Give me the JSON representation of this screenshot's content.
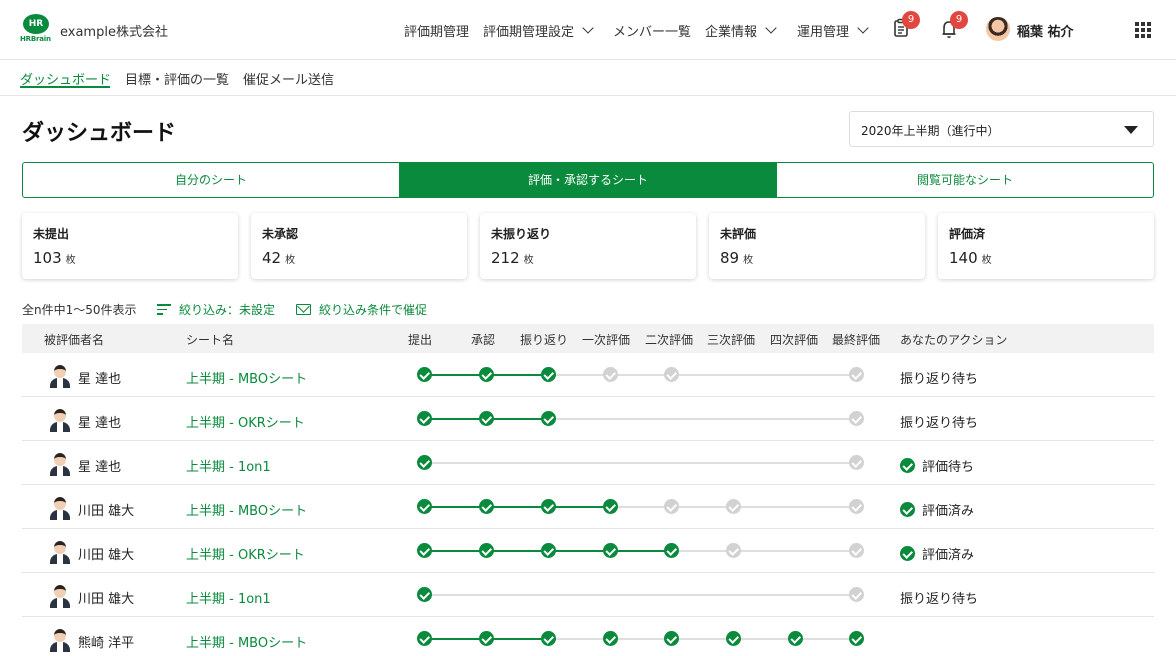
{
  "header": {
    "logo_text": "HR",
    "logo_sub": "HRBrain",
    "company": "example株式会社",
    "nav": [
      {
        "label": "評価期管理",
        "dropdown": false
      },
      {
        "label": "評価期管理設定",
        "dropdown": true
      },
      {
        "label": "メンバー一覧",
        "dropdown": false
      },
      {
        "label": "企業情報",
        "dropdown": true
      },
      {
        "label": "運用管理",
        "dropdown": true
      }
    ],
    "tasks_badge": "9",
    "notifications_badge": "9",
    "user_name": "稲葉 祐介"
  },
  "subnav": {
    "items": [
      "ダッシュボード",
      "目標・評価の一覧",
      "催促メール送信"
    ],
    "active": "ダッシュボード"
  },
  "page": {
    "title": "ダッシュボード",
    "period": "2020年上半期（進行中）"
  },
  "tabs": {
    "items": [
      "自分のシート",
      "評価・承認するシート",
      "閲覧可能なシート"
    ],
    "active_index": 1
  },
  "summary": {
    "unit": "枚",
    "cards": [
      {
        "label": "未提出",
        "value": "103"
      },
      {
        "label": "未承認",
        "value": "42"
      },
      {
        "label": "未振り返り",
        "value": "212"
      },
      {
        "label": "未評価",
        "value": "89"
      },
      {
        "label": "評価済",
        "value": "140"
      }
    ]
  },
  "list": {
    "count_text": "全n件中1〜50件表示",
    "filter_text": "絞り込み：未設定",
    "remind_text": "絞り込み条件で催促"
  },
  "table": {
    "columns": {
      "evaluatee": "被評価者名",
      "sheet": "シート名",
      "steps": [
        "提出",
        "承認",
        "振り返り",
        "一次評価",
        "二次評価",
        "三次評価",
        "四次評価",
        "最終評価"
      ],
      "action": "あなたのアクション"
    },
    "rows": [
      {
        "name": "星 達也",
        "sheet": "上半期 - MBOシート",
        "steps": [
          "done",
          "done",
          "done",
          "todo",
          "todo",
          null,
          null,
          "todo"
        ],
        "fill_to": 2,
        "action": "振り返り待ち",
        "action_ok": false
      },
      {
        "name": "星 達也",
        "sheet": "上半期 -  OKRシート",
        "steps": [
          "done",
          "done",
          "done",
          null,
          null,
          null,
          null,
          "todo"
        ],
        "fill_to": 2,
        "action": "振り返り待ち",
        "action_ok": false
      },
      {
        "name": "星 達也",
        "sheet": "上半期 - 1on1",
        "steps": [
          "done",
          null,
          null,
          null,
          null,
          null,
          null,
          "todo"
        ],
        "fill_to": 0,
        "action": "評価待ち",
        "action_ok": true
      },
      {
        "name": "川田 雄大",
        "sheet": "上半期 - MBOシート",
        "steps": [
          "done",
          "done",
          "done",
          "done",
          "todo",
          "todo",
          null,
          "todo"
        ],
        "fill_to": 3,
        "action": "評価済み",
        "action_ok": true
      },
      {
        "name": "川田 雄大",
        "sheet": "上半期 -  OKRシート",
        "steps": [
          "done",
          "done",
          "done",
          "done",
          "done",
          "todo",
          null,
          "todo"
        ],
        "fill_to": 4,
        "action": "評価済み",
        "action_ok": true
      },
      {
        "name": "川田 雄大",
        "sheet": "上半期 - 1on1",
        "steps": [
          "done",
          null,
          null,
          null,
          null,
          null,
          null,
          "todo"
        ],
        "fill_to": 0,
        "action": "振り返り待ち",
        "action_ok": false
      },
      {
        "name": "熊崎 洋平",
        "sheet": "上半期 - MBOシート",
        "steps": [
          "done",
          "done",
          "done",
          "done",
          "done",
          "done",
          "done",
          "done"
        ],
        "fill_to": 2,
        "action": "",
        "action_ok": false
      }
    ]
  },
  "colors": {
    "brand": "#0a8a3c",
    "badge": "#e2473f",
    "step_todo": "#d2d2d2"
  }
}
